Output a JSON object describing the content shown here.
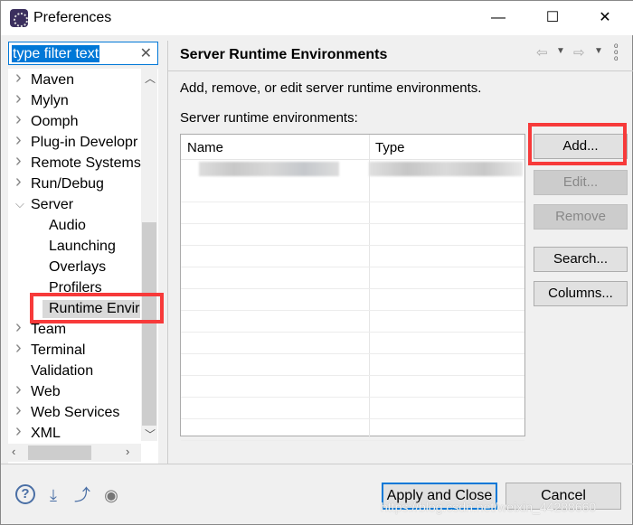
{
  "window": {
    "title": "Preferences",
    "minimize": "—",
    "maximize": "☐",
    "close": "✕"
  },
  "filter": {
    "value": "type filter text"
  },
  "tree": [
    {
      "label": "Maven",
      "exp": "collapsed",
      "lvl": 0
    },
    {
      "label": "Mylyn",
      "exp": "collapsed",
      "lvl": 0
    },
    {
      "label": "Oomph",
      "exp": "collapsed",
      "lvl": 0
    },
    {
      "label": "Plug-in Developr",
      "exp": "collapsed",
      "lvl": 0
    },
    {
      "label": "Remote Systems",
      "exp": "collapsed",
      "lvl": 0
    },
    {
      "label": "Run/Debug",
      "exp": "collapsed",
      "lvl": 0
    },
    {
      "label": "Server",
      "exp": "expanded",
      "lvl": 0
    },
    {
      "label": "Audio",
      "exp": "none",
      "lvl": 1
    },
    {
      "label": "Launching",
      "exp": "none",
      "lvl": 1
    },
    {
      "label": "Overlays",
      "exp": "none",
      "lvl": 1
    },
    {
      "label": "Profilers",
      "exp": "none",
      "lvl": 1
    },
    {
      "label": "Runtime Envir",
      "exp": "none",
      "lvl": 1,
      "selected": true
    },
    {
      "label": "Team",
      "exp": "collapsed",
      "lvl": 0
    },
    {
      "label": "Terminal",
      "exp": "collapsed",
      "lvl": 0
    },
    {
      "label": "Validation",
      "exp": "none",
      "lvl": 0
    },
    {
      "label": "Web",
      "exp": "collapsed",
      "lvl": 0
    },
    {
      "label": "Web Services",
      "exp": "collapsed",
      "lvl": 0
    },
    {
      "label": "XML",
      "exp": "collapsed",
      "lvl": 0
    }
  ],
  "page": {
    "title": "Server Runtime Environments",
    "description": "Add, remove, or edit server runtime environments.",
    "list_label": "Server runtime environments:"
  },
  "table": {
    "columns": [
      "Name",
      "Type"
    ]
  },
  "buttons": {
    "add": "Add...",
    "edit": "Edit...",
    "remove": "Remove",
    "search": "Search...",
    "columns": "Columns..."
  },
  "footer": {
    "apply_close": "Apply and Close",
    "cancel": "Cancel"
  },
  "watermark": "https://blog.csdn.net/weixin_44288660",
  "colors": {
    "accent": "#0078d7",
    "highlight": "#f73a3a"
  }
}
